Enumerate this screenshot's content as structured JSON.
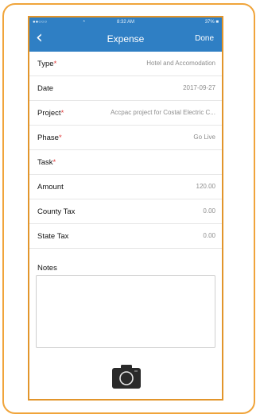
{
  "status": {
    "carrier": "●●○○○",
    "time": "8:32 AM",
    "battery": "37% ■"
  },
  "nav": {
    "title": "Expense",
    "done_label": "Done"
  },
  "fields": [
    {
      "label": "Type",
      "required": "*",
      "value": "Hotel and Accomodation"
    },
    {
      "label": "Date",
      "required": "",
      "value": "2017-09-27"
    },
    {
      "label": "Project",
      "required": "*",
      "value": "Accpac project for Costal Electric C..."
    },
    {
      "label": "Phase",
      "required": "*",
      "value": "Go Live"
    },
    {
      "label": "Task",
      "required": "*",
      "value": ""
    },
    {
      "label": "Amount",
      "required": "",
      "value": "120.00"
    },
    {
      "label": "County Tax",
      "required": "",
      "value": "0.00"
    },
    {
      "label": "State Tax",
      "required": "",
      "value": "0.00"
    }
  ],
  "notes": {
    "label": "Notes",
    "value": ""
  },
  "icons": {
    "back": "chevron-left-icon",
    "camera": "camera-icon",
    "wifi": "wifi-icon"
  },
  "colors": {
    "accent": "#2f7fc4",
    "required": "#e03a3a",
    "frame": "#f0a43a"
  }
}
